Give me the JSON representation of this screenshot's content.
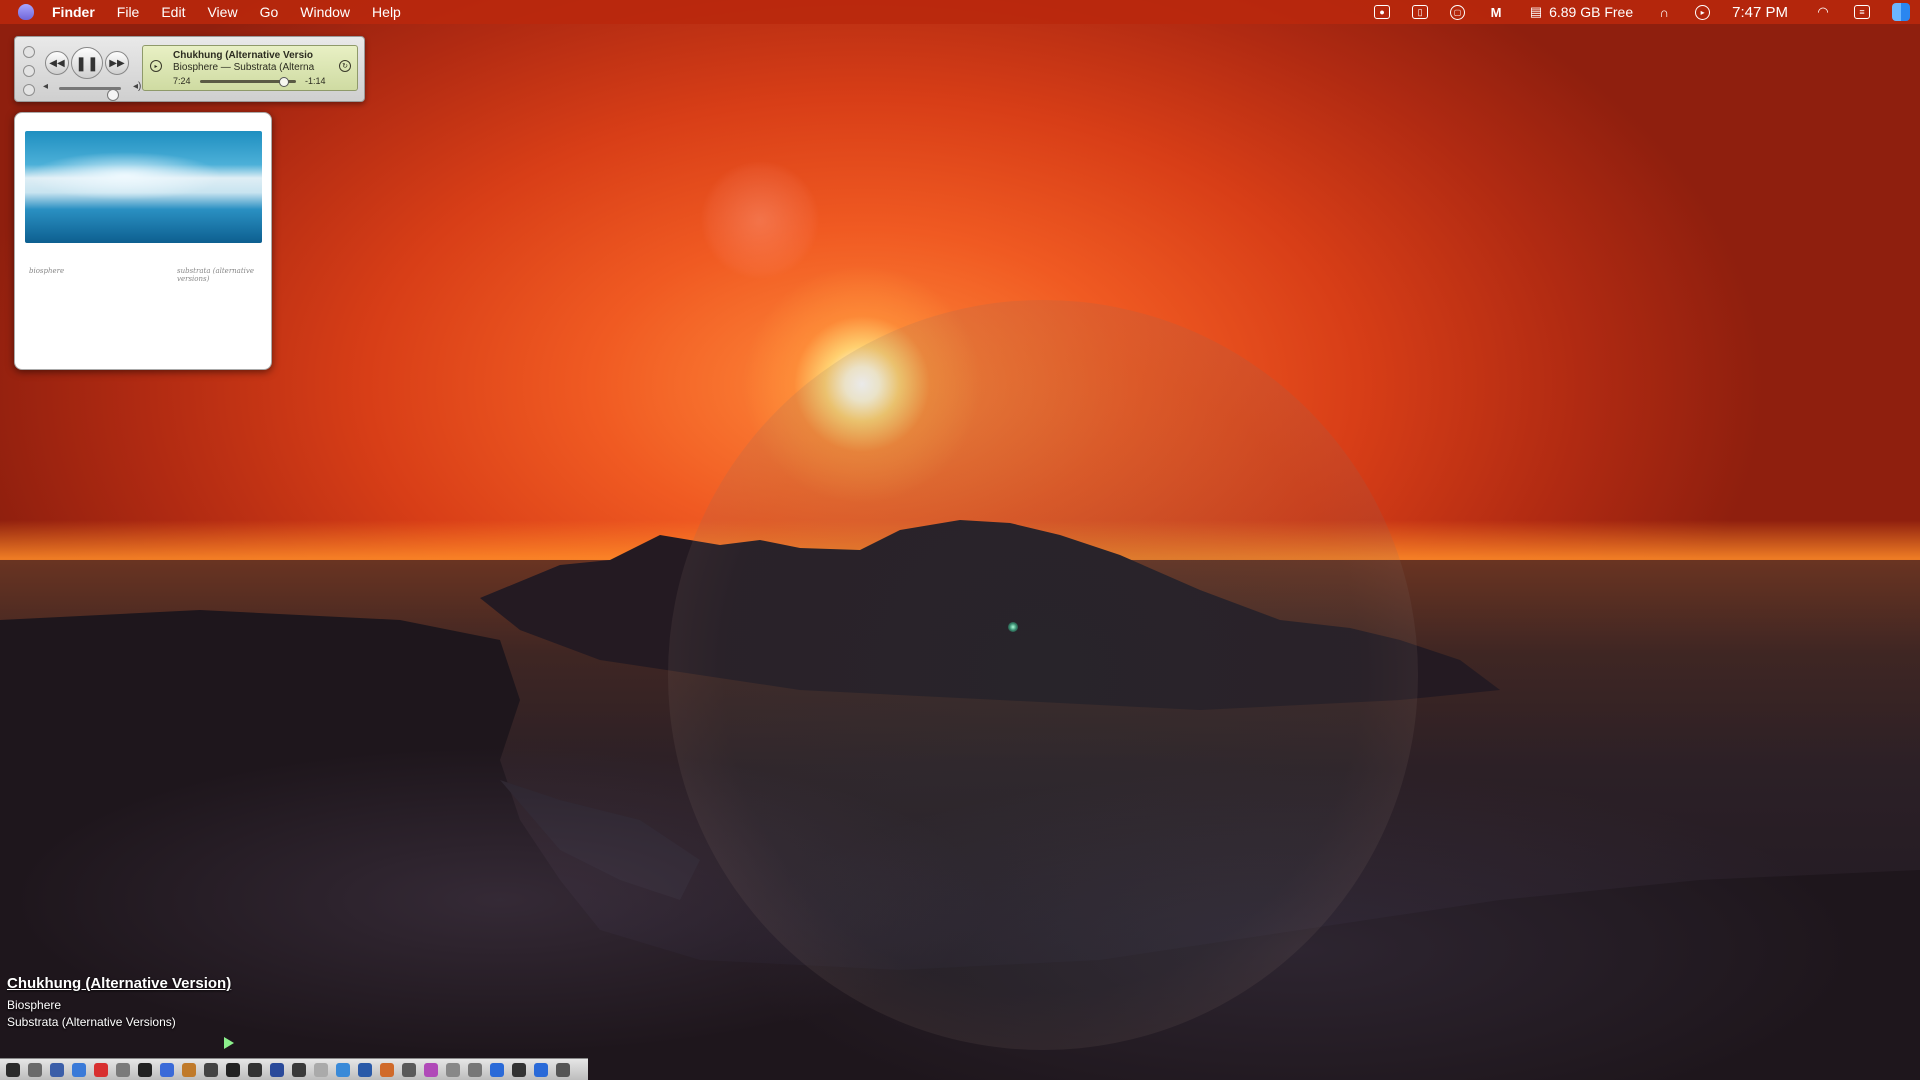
{
  "menubar": {
    "app_name": "Finder",
    "menus": [
      "File",
      "Edit",
      "View",
      "Go",
      "Window",
      "Help"
    ],
    "disk_free": "6.89 GB Free",
    "clock": "7:47 PM",
    "status_icons": [
      "screen-record-icon",
      "sidebar-icon",
      "clipboard-icon",
      "malwarebytes-icon",
      "disk-icon",
      "headphones-icon",
      "play-circle-icon",
      "wifi-icon",
      "control-center-icon",
      "finder-face-icon"
    ]
  },
  "player": {
    "track": "Chukhung  (Alternative Versio",
    "artist_album": "Biosphere — Substrata (Alterna",
    "elapsed": "7:24",
    "remaining": "-1:14",
    "progress_fraction": 0.86,
    "volume_fraction": 0.85,
    "icons": [
      "prev-icon",
      "pause-icon",
      "next-icon",
      "volume-low-icon",
      "volume-high-icon"
    ]
  },
  "album_art": {
    "caption_left": "biosphere",
    "caption_right": "substrata (alternative versions)"
  },
  "now_playing": {
    "title": "Chukhung  (Alternative Version)",
    "artist": "Biosphere",
    "album": "Substrata (Alternative Versions)"
  },
  "colors": {
    "menubar": "#b9280c",
    "dock_icons": [
      "#2a2a2a",
      "#6a6a6a",
      "#3b5ea8",
      "#3a7ad8",
      "#d83030",
      "#7a7a7a",
      "#222",
      "#3a6ad8",
      "#c07a2a",
      "#444",
      "#222",
      "#333",
      "#2a4a9a",
      "#3a3a3a",
      "#aaa",
      "#3a8ad8",
      "#2a5aa8",
      "#d06a2a",
      "#5a5a5a",
      "#b04ab8",
      "#888",
      "#777",
      "#2a6ad8",
      "#333",
      "#2a6ad8",
      "#555"
    ]
  }
}
